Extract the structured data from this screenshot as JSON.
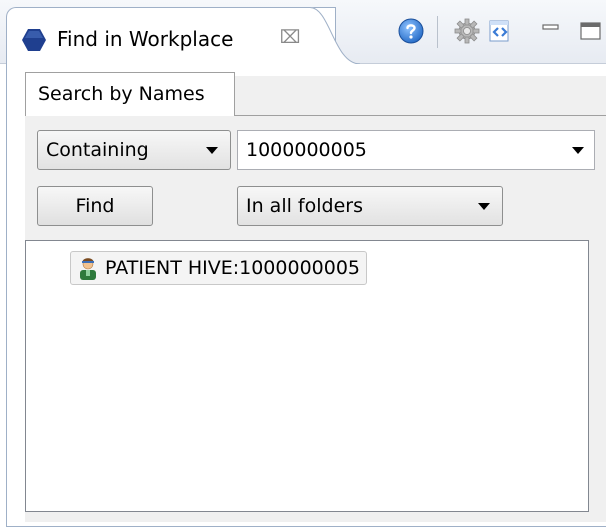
{
  "view": {
    "title": "Find in Workplace",
    "close_glyph": "⌧",
    "icons": [
      "view-hexagon-icon",
      "help-icon",
      "gear-icon",
      "link-icon",
      "minimize-icon",
      "maximize-icon"
    ]
  },
  "tabs": [
    {
      "label": "Search by Names",
      "active": true
    }
  ],
  "search": {
    "match_mode": "Containing",
    "query": "1000000005",
    "find_label": "Find",
    "scope": "In all folders"
  },
  "results": [
    {
      "label": "PATIENT HIVE:1000000005",
      "icon": "patient-icon"
    }
  ],
  "colors": {
    "view_icon": "#1f3f8f",
    "help_icon": "#2a6fc9",
    "link_icon": "#3a7bd5",
    "panel_bg": "#f0f0f0",
    "tab_border": "#9fb0c7"
  }
}
